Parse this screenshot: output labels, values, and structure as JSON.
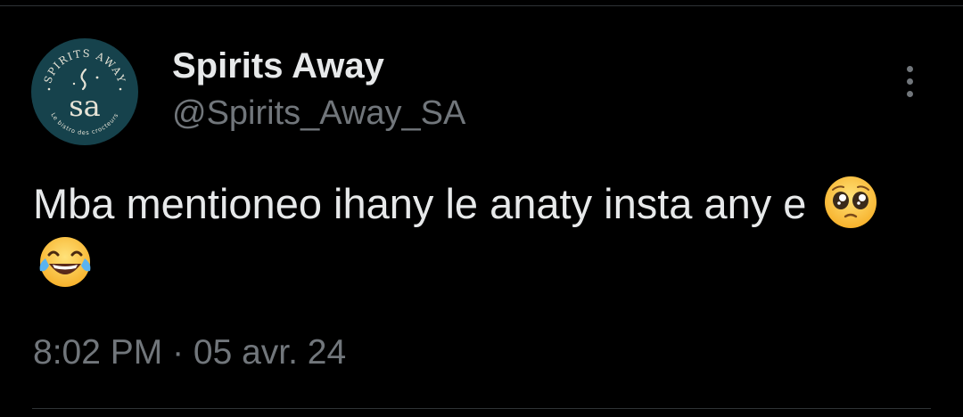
{
  "tweet": {
    "author": {
      "display_name": "Spirits Away",
      "handle": "@Spirits_Away_SA",
      "avatar": {
        "ring_text_top": "SPIRITS AWAY",
        "ring_text_bottom": "Le bistro des crocteurs",
        "monogram": "sa",
        "background_color": "#16424c",
        "foreground_color": "#e6e3d6"
      }
    },
    "more_icon": "more-vertical-icon",
    "text": "Mba mentioneo ihany le anaty insta any e",
    "emojis": [
      "pleading-face",
      "face-with-tears-of-joy"
    ],
    "timestamp": "8:02 PM · 05 avr. 24"
  },
  "colors": {
    "background": "#000000",
    "primary_text": "#e7e9ea",
    "secondary_text": "#71767b",
    "divider": "#2f3336"
  }
}
